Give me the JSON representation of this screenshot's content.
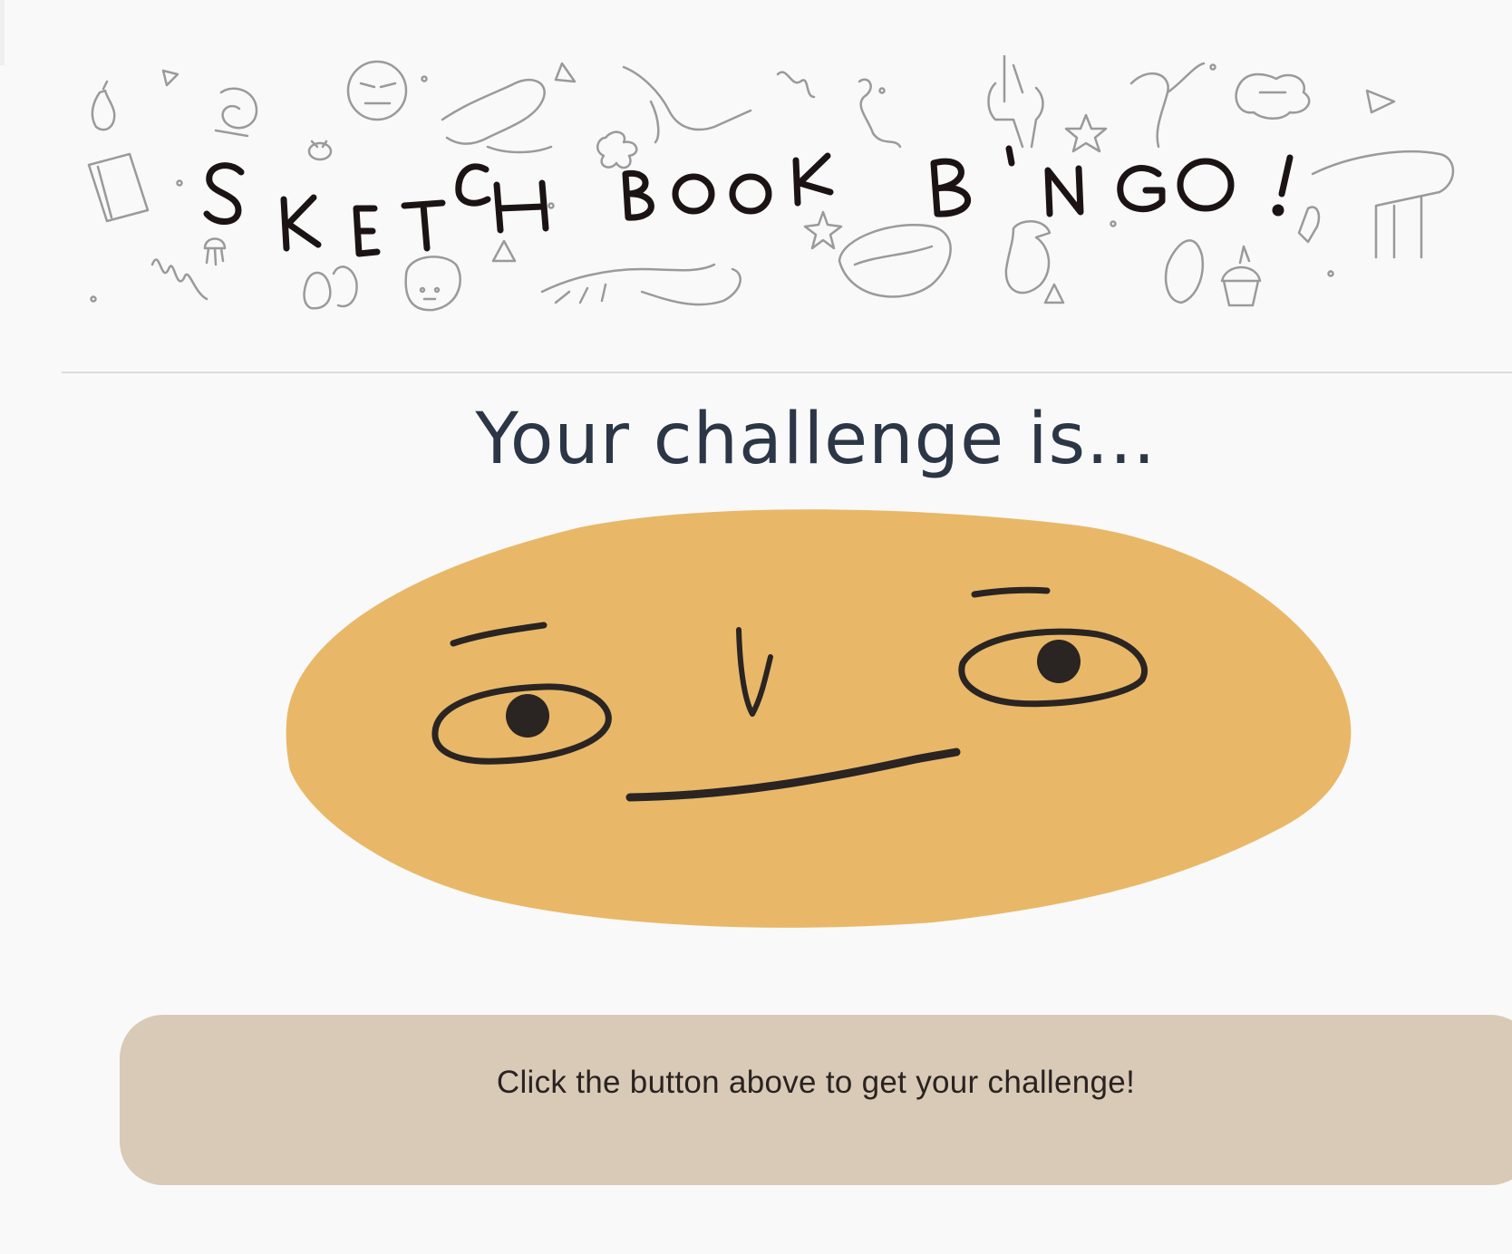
{
  "banner": {
    "title": "SKETCH BOOK BINGO!",
    "doodles": [
      "pear-icon",
      "triangle-icon",
      "snail-icon",
      "grumpy-face-icon",
      "swirl-icon",
      "dragon-icon",
      "hummingbird-icon",
      "flower-icon",
      "squiggle-icon",
      "deer-icon",
      "star-icon",
      "squirrel-icon",
      "cloud-face-icon",
      "notebook-icon",
      "bee-icon",
      "jellyfish-icon",
      "shoes-icon",
      "toast-icon",
      "lobster-icon",
      "bowl-icon",
      "bird-with-hat-icon",
      "fish-icon",
      "cupcake-icon",
      "piano-icon",
      "hand-icon"
    ]
  },
  "main": {
    "heading": "Your challenge is...",
    "challenge_placeholder": "Click the button above to get your challenge!"
  },
  "colors": {
    "background": "#f9f9f9",
    "heading": "#2b3646",
    "face": "#e8b868",
    "challenge_box": "#d9cab8",
    "ink": "#1c1414"
  }
}
